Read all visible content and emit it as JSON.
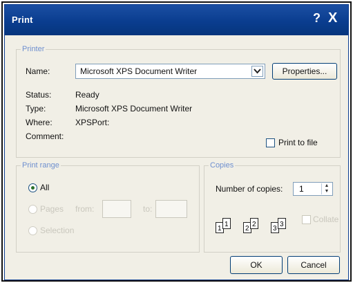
{
  "window": {
    "title": "Print",
    "help_glyph": "?",
    "close_glyph": "X"
  },
  "printer": {
    "legend": "Printer",
    "name_label": "Name:",
    "selected_printer": "Microsoft XPS Document Writer",
    "properties_button": "Properties...",
    "status_label": "Status:",
    "status_value": "Ready",
    "type_label": "Type:",
    "type_value": "Microsoft XPS Document Writer",
    "where_label": "Where:",
    "where_value": "XPSPort:",
    "comment_label": "Comment:",
    "print_to_file_label": "Print to file",
    "print_to_file_checked": false
  },
  "print_range": {
    "legend": "Print range",
    "all_label": "All",
    "all_selected": true,
    "pages_label": "Pages",
    "from_label": "from:",
    "to_label": "to:",
    "selection_label": "Selection"
  },
  "copies": {
    "legend": "Copies",
    "number_label": "Number of copies:",
    "number_value": "1",
    "collate_label": "Collate",
    "collate_pages": [
      "1",
      "1",
      "2",
      "2",
      "3",
      "3"
    ]
  },
  "buttons": {
    "ok": "OK",
    "cancel": "Cancel"
  },
  "icons": {
    "dropdown": "chevron-down-icon",
    "spinner": "spinner-arrows-icon"
  }
}
